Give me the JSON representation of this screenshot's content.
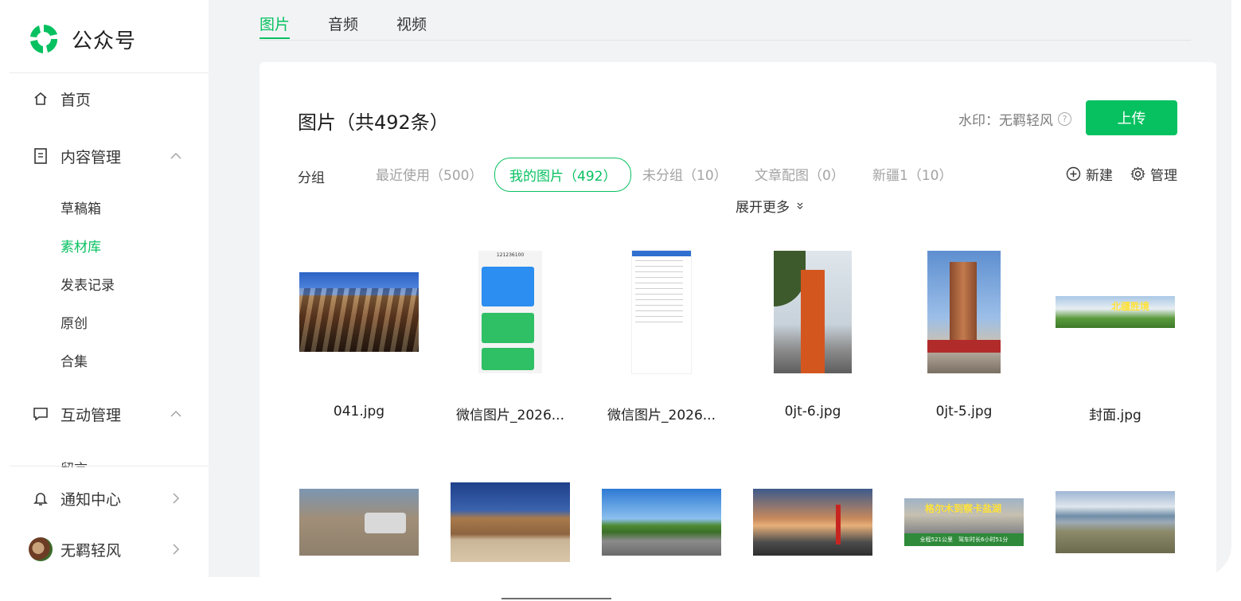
{
  "app": {
    "name": "公众号"
  },
  "sidebar": {
    "home": "首页",
    "content": "内容管理",
    "content_sub": [
      "草稿箱",
      "素材库",
      "发表记录",
      "原创",
      "合集"
    ],
    "interaction": "互动管理",
    "interaction_sub_partial": "留言",
    "notifications": "通知中心",
    "account": "无羁轻风"
  },
  "tabs": [
    "图片",
    "音频",
    "视频"
  ],
  "main": {
    "heading": "图片（共492条）",
    "watermark": "水印：无羁轻风",
    "upload": "上传",
    "group_label": "分组",
    "groups": [
      "最近使用（500）",
      "我的图片（492）",
      "未分组（10）",
      "文章配图（0）",
      "新疆1（10）"
    ],
    "new": "新建",
    "manage": "管理",
    "expand": "展开更多"
  },
  "phone_shot": {
    "number": "121236100"
  },
  "images_row1": [
    "041.jpg",
    "微信图片_2026...",
    "微信图片_2026...",
    "0jt-6.jpg",
    "0jt-5.jpg",
    "封面.jpg"
  ],
  "thumb_text": {
    "banner1": "北疆胜境",
    "banner2_title": "格尔木到察卡盐湖",
    "banner2_sub": "全程521公里　驾车时长6小时51分"
  },
  "colors": {
    "accent": "#07c160",
    "muted": "#a3a3a3"
  }
}
